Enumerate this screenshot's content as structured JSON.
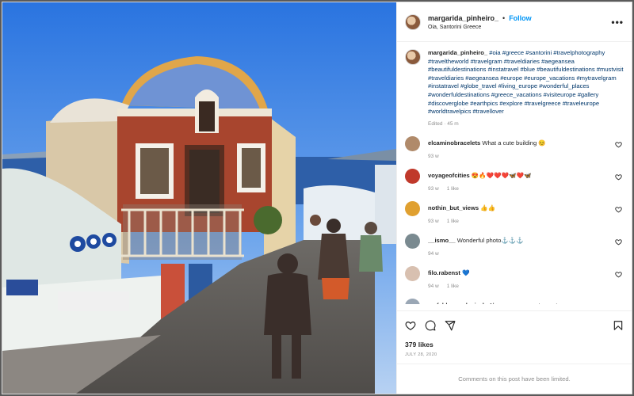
{
  "post": {
    "username": "margarida_pinheiro_",
    "separator": "•",
    "follow_label": "Follow",
    "location": "Oia, Santorini Greece",
    "more_label": "•••",
    "caption_user": "margarida_pinheiro_",
    "caption_tags": "#oia #greece #santorini #travelphotography #traveltheworld #travelgram #traveldiaries #aegeansea #beautifuldestinations #instatravel #blue #beautifuldestinations #mustvisit #traveldiaries #aegeansea #europe #europe_vacations #mytravelgram #instatravel #globe_travel #living_europe #wonderful_places #wonderfuldestinations #greece_vacations #visiteurope #gallery #discoverglobe #earthpics #explore #travelgreece #traveleurope #worldtravelpics #travellover",
    "edited": "Edited · 45 m",
    "likes": "379 likes",
    "date": "JULY 28, 2020",
    "comments_limited": "Comments on this post have been limited."
  },
  "comments": [
    {
      "user": "elcaminobracelets",
      "text": "What a cute building 😊",
      "time": "93 w",
      "likes": "",
      "avatar_color": "#b08a6a"
    },
    {
      "user": "voyageofcities",
      "text": "😍🔥❤️❤️❤️🦋❤️🦋",
      "time": "93 w",
      "likes": "1 like",
      "avatar_color": "#c0392b"
    },
    {
      "user": "nothin_but_views",
      "text": "👍👍",
      "time": "93 w",
      "likes": "1 like",
      "avatar_color": "#e0a030"
    },
    {
      "user": "__ismo__",
      "text": "Wonderful photo⚓⚓⚓",
      "time": "94 w",
      "likes": "",
      "avatar_color": "#7a8a90"
    },
    {
      "user": "filo.rabenst",
      "text": "💙",
      "time": "94 w",
      "likes": "1 like",
      "avatar_color": "#d8c0b0"
    },
    {
      "user": "mafaldaazmelovizela",
      "text": "Almoçamos no restaurante mesmo em",
      "time": "",
      "likes": "",
      "avatar_color": "#9aa7b5"
    }
  ],
  "colors": {
    "link": "#00376b",
    "follow": "#0095f6",
    "muted": "#8e8e8e"
  },
  "icons": [
    "heart-icon",
    "comment-icon",
    "share-icon",
    "bookmark-icon",
    "more-icon"
  ]
}
